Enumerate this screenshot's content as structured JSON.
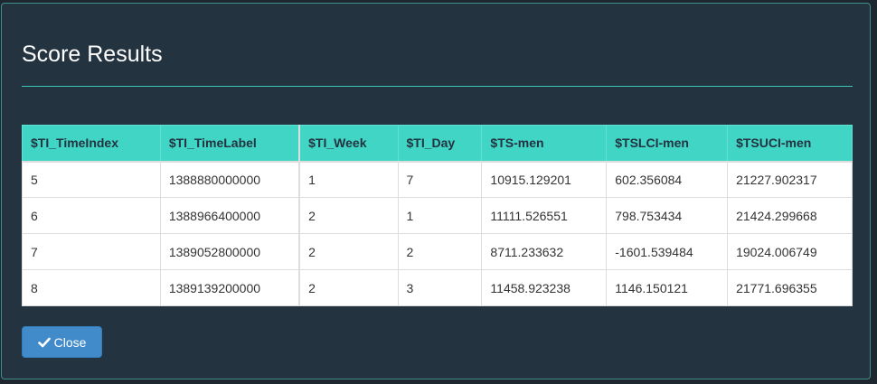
{
  "modal": {
    "title": "Score Results",
    "close_label": "Close",
    "close_icon": "check-icon"
  },
  "table": {
    "columns": [
      "$TI_TimeIndex",
      "$TI_TimeLabel",
      "$TI_Week",
      "$TI_Day",
      "$TS-men",
      "$TSLCI-men",
      "$TSUCI-men"
    ],
    "rows": [
      [
        "5",
        "1388880000000",
        "1",
        "7",
        "10915.129201",
        "602.356084",
        "21227.902317"
      ],
      [
        "6",
        "1388966400000",
        "2",
        "1",
        "11111.526551",
        "798.753434",
        "21424.299668"
      ],
      [
        "7",
        "1389052800000",
        "2",
        "2",
        "8711.233632",
        "-1601.539484",
        "19024.006749"
      ],
      [
        "8",
        "1389139200000",
        "2",
        "3",
        "11458.923238",
        "1146.150121",
        "21771.696355"
      ]
    ]
  },
  "colors": {
    "header_bg": "#40d5c5",
    "modal_bg": "#243340",
    "button_bg": "#428bca"
  }
}
